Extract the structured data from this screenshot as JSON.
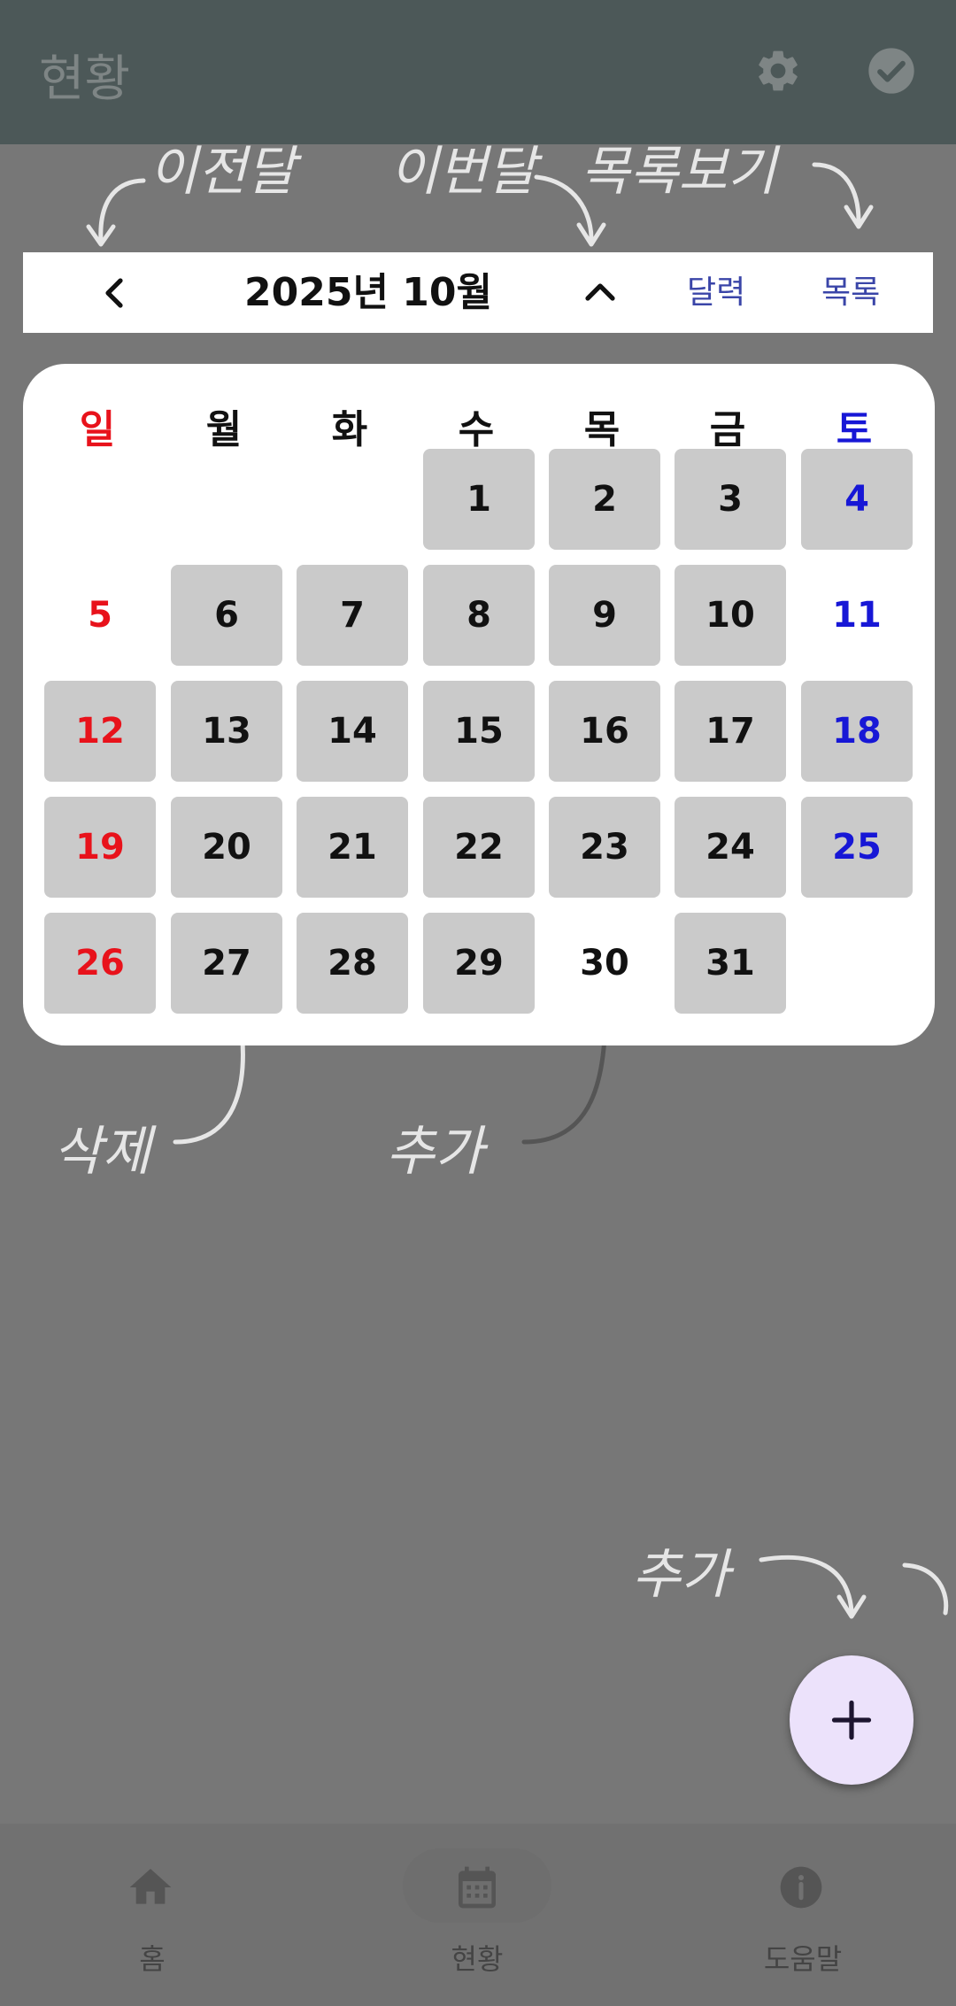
{
  "appbar": {
    "title": "현황",
    "actions": [
      "gear-icon",
      "check-circle-icon"
    ]
  },
  "hints": {
    "prev_month": "이전달",
    "this_month": "이번달",
    "list_view": "목록보기",
    "delete": "삭제",
    "add_day": "추가",
    "add_fab": "추가"
  },
  "nav": {
    "month_label": "2025년 10월",
    "calendar_label": "달력",
    "list_label": "목록"
  },
  "calendar": {
    "weekdays": [
      "일",
      "월",
      "화",
      "수",
      "목",
      "금",
      "토"
    ],
    "days": [
      "1",
      "2",
      "3",
      "4",
      "5",
      "6",
      "7",
      "8",
      "9",
      "10",
      "11",
      "12",
      "13",
      "14",
      "15",
      "16",
      "17",
      "18",
      "19",
      "20",
      "21",
      "22",
      "23",
      "24",
      "25",
      "26",
      "27",
      "28",
      "29",
      "30",
      "31"
    ]
  },
  "colors": {
    "sunday": "#e8121b",
    "saturday": "#1717d6",
    "filled_day": "#cacaca",
    "fab": "#ece2fb"
  },
  "fab": {
    "icon": "plus-icon"
  },
  "bottom_nav": {
    "tabs": [
      {
        "label": "홈",
        "icon": "home-icon"
      },
      {
        "label": "현황",
        "icon": "calendar-icon",
        "active": true
      },
      {
        "label": "도움말",
        "icon": "info-icon"
      }
    ]
  }
}
